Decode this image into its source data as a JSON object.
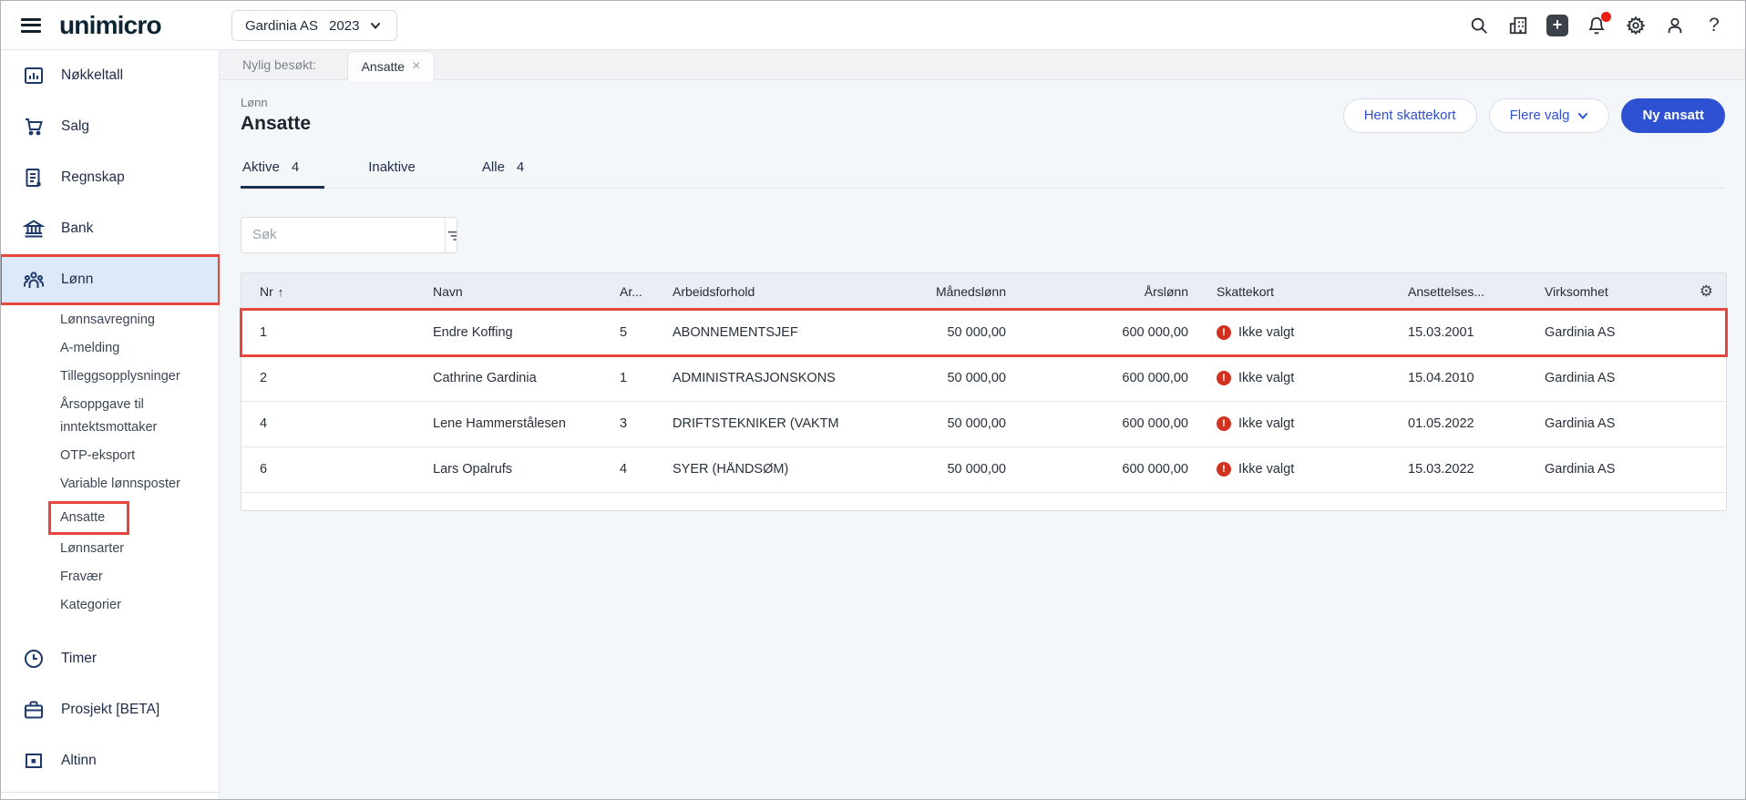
{
  "colors": {
    "accent_blue": "#2d51d2",
    "annotation_red": "#e8463c",
    "error_red": "#d2311f",
    "active_item_bg": "#dde8f8",
    "header_bg": "#e9edf4"
  },
  "icons": {
    "settings_glyph": "⚙",
    "error_glyph": "!",
    "help_glyph": "?",
    "close_glyph": "×",
    "sort_up_glyph": "↑",
    "plus_glyph": "+"
  },
  "topbar": {
    "logo": "unimicro",
    "company_selector": {
      "company": "Gardinia AS",
      "year": "2023"
    }
  },
  "sidebar": {
    "items": [
      {
        "label": "Nøkkeltall"
      },
      {
        "label": "Salg"
      },
      {
        "label": "Regnskap"
      },
      {
        "label": "Bank"
      },
      {
        "label": "Lønn"
      },
      {
        "label": "Timer"
      },
      {
        "label": "Prosjekt [BETA]"
      },
      {
        "label": "Altinn"
      }
    ],
    "lonn_submenu": [
      "Lønnsavregning",
      "A-melding",
      "Tilleggsopplysninger",
      "Årsoppgave til inntektsmottaker",
      "OTP-eksport",
      "Variable lønnsposter",
      "Ansatte",
      "Lønnsarter",
      "Fravær",
      "Kategorier"
    ]
  },
  "tabstrip": {
    "label": "Nylig besøkt:",
    "active_tab": "Ansatte"
  },
  "header": {
    "breadcrumb": "Lønn",
    "title": "Ansatte",
    "actions": {
      "hent": "Hent skattekort",
      "flere": "Flere valg",
      "ny": "Ny ansatt"
    }
  },
  "tabs": [
    {
      "label": "Aktive",
      "count": "4"
    },
    {
      "label": "Inaktive",
      "count": ""
    },
    {
      "label": "Alle",
      "count": "4"
    }
  ],
  "search": {
    "placeholder": "Søk"
  },
  "table": {
    "columns": [
      "Nr",
      "Navn",
      "Ar...",
      "Arbeidsforhold",
      "Månedslønn",
      "Årslønn",
      "Skattekort",
      "Ansettelses...",
      "Virksomhet"
    ],
    "rows": [
      {
        "nr": "1",
        "navn": "Endre Koffing",
        "ar": "5",
        "arbeidsforhold": "ABONNEMENTSJEF",
        "manedslonn": "50 000,00",
        "arslonn": "600 000,00",
        "skattekort": "Ikke valgt",
        "ansettelse": "15.03.2001",
        "virksomhet": "Gardinia AS"
      },
      {
        "nr": "2",
        "navn": "Cathrine Gardinia",
        "ar": "1",
        "arbeidsforhold": "ADMINISTRASJONSKONS",
        "manedslonn": "50 000,00",
        "arslonn": "600 000,00",
        "skattekort": "Ikke valgt",
        "ansettelse": "15.04.2010",
        "virksomhet": "Gardinia AS"
      },
      {
        "nr": "4",
        "navn": "Lene Hammerstålesen",
        "ar": "3",
        "arbeidsforhold": "DRIFTSTEKNIKER (VAKTM",
        "manedslonn": "50 000,00",
        "arslonn": "600 000,00",
        "skattekort": "Ikke valgt",
        "ansettelse": "01.05.2022",
        "virksomhet": "Gardinia AS"
      },
      {
        "nr": "6",
        "navn": "Lars Opalrufs",
        "ar": "4",
        "arbeidsforhold": "SYER (HÅNDSØM)",
        "manedslonn": "50 000,00",
        "arslonn": "600 000,00",
        "skattekort": "Ikke valgt",
        "ansettelse": "15.03.2022",
        "virksomhet": "Gardinia AS"
      }
    ]
  }
}
